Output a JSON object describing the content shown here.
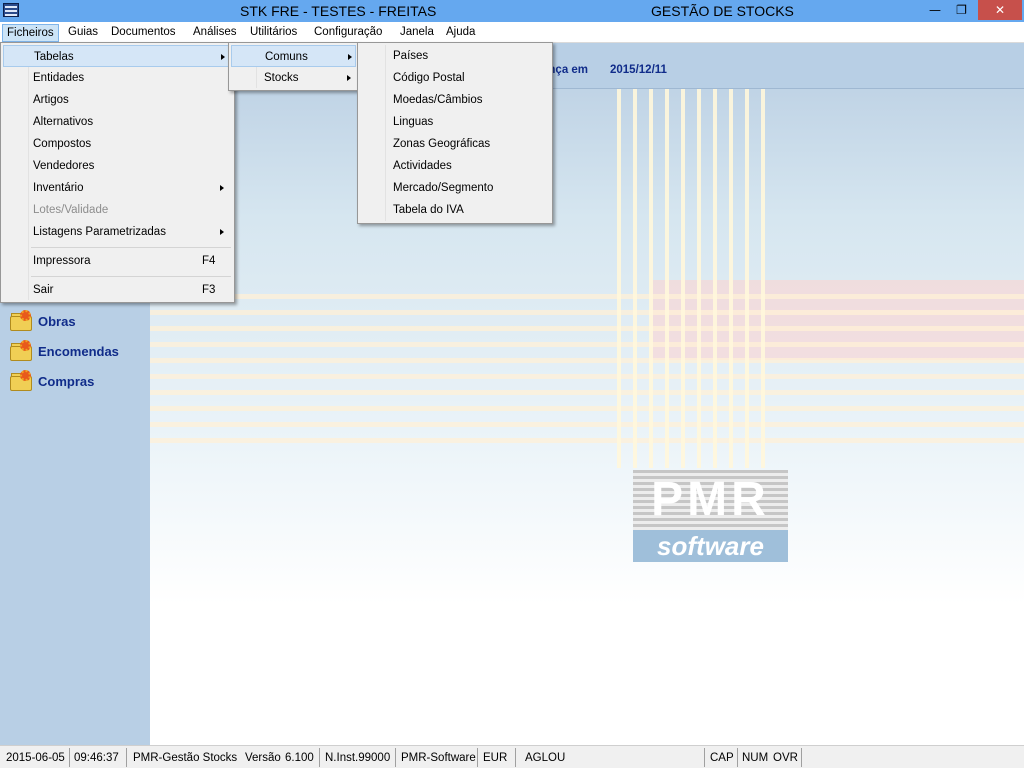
{
  "window": {
    "title_left": "STK FRE - TESTES - FREITAS",
    "title_right": "GESTÃO DE STOCKS",
    "min_glyph": "—",
    "restore_glyph": "❐",
    "close_glyph": "✕"
  },
  "menubar": [
    {
      "label": "Ficheiros"
    },
    {
      "label": "Guias"
    },
    {
      "label": "Documentos"
    },
    {
      "label": "Análises"
    },
    {
      "label": "Utilitários"
    },
    {
      "label": "Configuração"
    },
    {
      "label": "Janela"
    },
    {
      "label": "Ajuda"
    }
  ],
  "ficheiros_menu": [
    {
      "label": "Tabelas",
      "submenu": true
    },
    {
      "label": "Entidades"
    },
    {
      "label": "Artigos"
    },
    {
      "label": "Alternativos"
    },
    {
      "label": "Compostos"
    },
    {
      "label": "Vendedores"
    },
    {
      "label": "Inventário",
      "submenu": true
    },
    {
      "label": "Lotes/Validade",
      "disabled": true
    },
    {
      "label": "Listagens Parametrizadas",
      "submenu": true
    },
    {
      "label": "Impressora",
      "shortcut": "F4"
    },
    {
      "label": "Sair",
      "shortcut": "F3"
    }
  ],
  "tabelas_menu": [
    {
      "label": "Comuns",
      "submenu": true
    },
    {
      "label": "Stocks",
      "submenu": true
    }
  ],
  "comuns_menu": [
    {
      "label": "Países"
    },
    {
      "label": "Código Postal"
    },
    {
      "label": "Moedas/Câmbios"
    },
    {
      "label": "Linguas"
    },
    {
      "label": "Zonas Geográficas"
    },
    {
      "label": "Actividades"
    },
    {
      "label": "Mercado/Segmento"
    },
    {
      "label": "Tabela do IVA"
    }
  ],
  "sidebar": [
    {
      "label": "Obras",
      "icon": "folder-gear-icon"
    },
    {
      "label": "Encomendas",
      "icon": "folder-gear-icon"
    },
    {
      "label": "Compras",
      "icon": "folder-gear-icon"
    }
  ],
  "infobar": {
    "text": "ança em",
    "date": "2015/12/11"
  },
  "logo": {
    "top": "PMR",
    "bottom": "software"
  },
  "statusbar": {
    "date": "2015-06-05",
    "time": "09:46:37",
    "app": "PMR-Gestão Stocks",
    "version_label": "Versão",
    "version": "6.100",
    "inst": "N.Inst.99000",
    "vendor": "PMR-Software",
    "currency": "EUR",
    "user": "AGLOU",
    "cap": "CAP",
    "num": "NUM",
    "ovr": "OVR"
  },
  "colors": {
    "titlebar": "#65a8ef",
    "sidebar": "#b8cfe5",
    "nav_text": "#102c8a",
    "close_button": "#c7504b"
  }
}
